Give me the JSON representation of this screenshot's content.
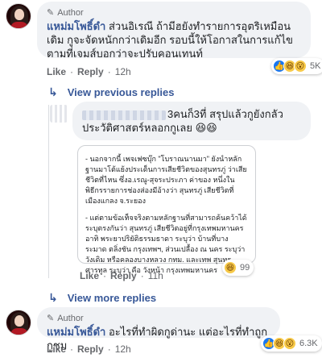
{
  "comments": {
    "c1": {
      "author_badge": "Author",
      "name": "แหม่มโพธิ์ดำ",
      "text": "ส่วนอิเรณี ถ้ามีฮยังทำรายการอุตริเหมือนเดิม กูจะจัดหนักกว่าเดิมอีก รอบนี้ให้โอกาสในการแก้ไข ตามที่เจมส์บอกว่าจะปรับคอนเทนท์",
      "like_label": "Like",
      "reply_label": "Reply",
      "time": "12h",
      "reaction_count": "5K"
    },
    "view_previous": "View previous replies",
    "c2": {
      "name_suffix": "3คนก็3ที่ สรุปแล้วกูยังกลัวประวัติศาสตร์หลอกกูเลย",
      "emoji": "😆😆",
      "card_paragraph_1": "- นอกจากนี้ เพจเฟซบุ๊ก \"โบราณนานมา\" ยังนำหลักฐานมาโต้แย้งประเด็นการเสียชีวิตของสุนทรภู่ ว่าเสียชีวิตที่ไหน ซึ่งอ.เรณู-สุจระประภา ค่าของ หนึ่งในพิธีกรรายการช่องส่องมีอ้างว่า สุนทรภู่ เสียชีวิตที่เมืองแกลง จ.ระยอง",
      "card_paragraph_2": "- แต่ตามข้อเท็จจริงตามหลักฐานที่สามารถค้นคว้าได้ ระบุตรงกันว่า สุนทรภู่ เสียชีวิตอยู่ที่กรุงเทพมหานคร อาทิ พระยาปริยัติธรรมธาดา ระบุว่า บ้านที่บางระมาด ตลิ่งชัน กรุงเทพฯ, ส่วนเปลื้อง ณ นคร ระบุว่า วังเดิม หรือคลองบางหลวง กทม. และเทพ สุนทรศารทูล ระบุว่า คือ วังหน้า กรุงเทพมหานคร",
      "like_label": "Like",
      "reply_label": "Reply",
      "time": "11h",
      "reaction_count": "99"
    },
    "view_more": "View more replies",
    "c3": {
      "author_badge": "Author",
      "name": "แหม่มโพธิ์ดำ",
      "text": "อะไรที่ทำผิดกูด่านะ แต่อะไรที่ทำถูกกูชม",
      "like_label": "Like",
      "reply_label": "Reply",
      "time": "12h",
      "reaction_count": "6.3K"
    }
  },
  "icons": {
    "author_badge": "pen-icon",
    "view_replies": "reply-arrow-icon",
    "reactions": [
      "like-icon",
      "haha-icon",
      "wow-icon"
    ]
  },
  "colors": {
    "name_link": "#385898",
    "bubble_bg": "#f0f2f5",
    "meta_text": "#65676b",
    "like_blue": "#1877f2"
  }
}
